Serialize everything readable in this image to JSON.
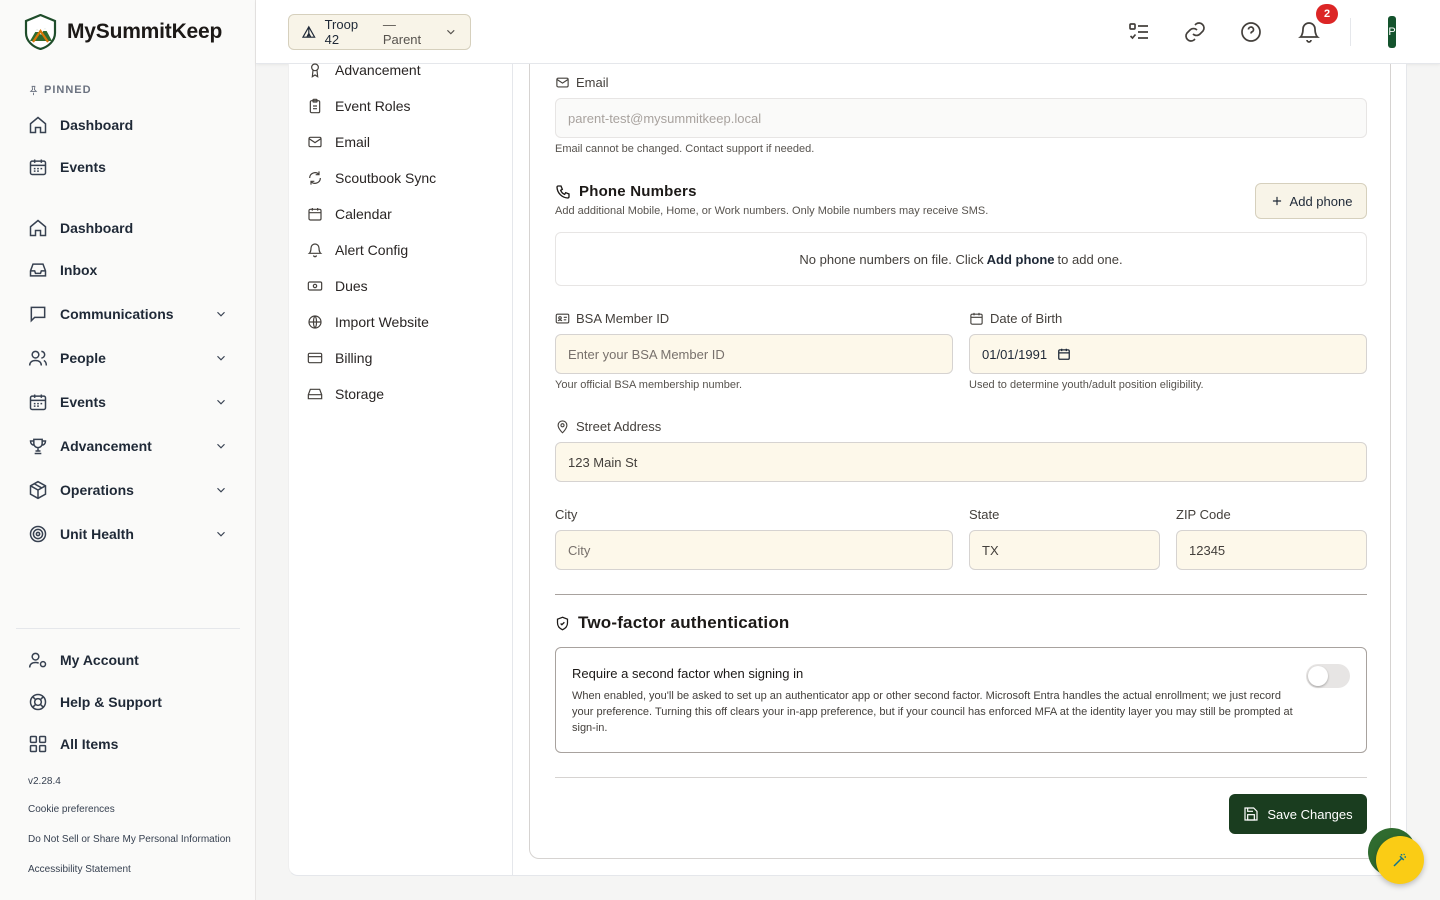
{
  "app": {
    "name": "MySummitKeep",
    "version": "v2.28.4"
  },
  "sidebar": {
    "pinned_label": "PINNED",
    "pinned": [
      {
        "label": "Dashboard",
        "icon": "home-icon"
      },
      {
        "label": "Events",
        "icon": "calendar-icon"
      }
    ],
    "items": [
      {
        "label": "Dashboard",
        "icon": "home-icon"
      },
      {
        "label": "Inbox",
        "icon": "inbox-icon"
      },
      {
        "label": "Communications",
        "icon": "message-icon",
        "expandable": true
      },
      {
        "label": "People",
        "icon": "users-icon",
        "expandable": true
      },
      {
        "label": "Events",
        "icon": "calendar-icon",
        "expandable": true
      },
      {
        "label": "Advancement",
        "icon": "trophy-icon",
        "expandable": true
      },
      {
        "label": "Operations",
        "icon": "package-icon",
        "expandable": true
      },
      {
        "label": "Unit Health",
        "icon": "target-icon",
        "expandable": true
      }
    ],
    "bottom": [
      {
        "label": "My Account",
        "icon": "user-cog-icon"
      },
      {
        "label": "Help & Support",
        "icon": "lifebuoy-icon"
      },
      {
        "label": "All Items",
        "icon": "grid-icon"
      }
    ],
    "footer_links": [
      "Cookie preferences",
      "Do Not Sell or Share My Personal Information",
      "Accessibility Statement"
    ]
  },
  "topbar": {
    "unit_name": "Troop 42",
    "unit_role": "— Parent",
    "notification_count": "2",
    "avatar_initial": "P"
  },
  "settings_nav": [
    {
      "label": "Advancement",
      "icon": "award-icon"
    },
    {
      "label": "Event Roles",
      "icon": "clipboard-icon"
    },
    {
      "label": "Email",
      "icon": "mail-icon"
    },
    {
      "label": "Scoutbook Sync",
      "icon": "refresh-icon"
    },
    {
      "label": "Calendar",
      "icon": "calendar-icon"
    },
    {
      "label": "Alert Config",
      "icon": "bell-icon"
    },
    {
      "label": "Dues",
      "icon": "money-icon"
    },
    {
      "label": "Import Website",
      "icon": "globe-icon"
    },
    {
      "label": "Billing",
      "icon": "credit-card-icon"
    },
    {
      "label": "Storage",
      "icon": "hard-drive-icon"
    }
  ],
  "form": {
    "email": {
      "label": "Email",
      "value": "parent-test@mysummitkeep.local",
      "hint": "Email cannot be changed. Contact support if needed."
    },
    "phones": {
      "title": "Phone Numbers",
      "subtitle": "Add additional Mobile, Home, or Work numbers. Only Mobile numbers may receive SMS.",
      "add_label": "Add phone",
      "empty_prefix": "No phone numbers on file. Click",
      "empty_action": "Add phone",
      "empty_suffix": "to add one."
    },
    "bsa_id": {
      "label": "BSA Member ID",
      "placeholder": "Enter your BSA Member ID",
      "hint": "Your official BSA membership number."
    },
    "dob": {
      "label": "Date of Birth",
      "value": "01/01/1991",
      "hint": "Used to determine youth/adult position eligibility."
    },
    "street": {
      "label": "Street Address",
      "value": "123 Main St"
    },
    "city": {
      "label": "City",
      "placeholder": "City"
    },
    "state": {
      "label": "State",
      "value": "TX"
    },
    "zip": {
      "label": "ZIP Code",
      "value": "12345"
    },
    "tfa": {
      "title": "Two-factor authentication",
      "option_title": "Require a second factor when signing in",
      "description": "When enabled, you'll be asked to set up an authenticator app or other second factor. Microsoft Entra handles the actual enrollment; we just record your preference. Turning this off clears your in-app preference, but if your council has enforced MFA at the identity layer you may still be prompted at sign-in.",
      "enabled": false
    },
    "save_label": "Save Changes"
  }
}
